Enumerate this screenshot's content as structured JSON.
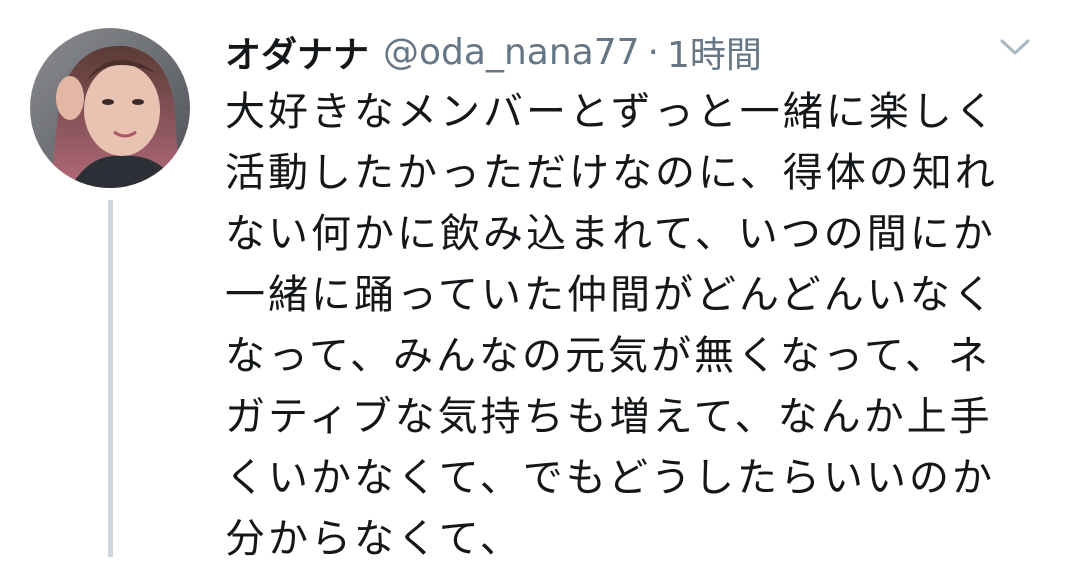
{
  "tweet": {
    "display_name": "オダナナ",
    "handle": "@oda_nana77",
    "separator": "·",
    "timestamp": "1時間",
    "avatar_icon": "profile-photo",
    "menu_icon": "chevron-down-icon",
    "body_lines": [
      "大好きなメンバーとずっと一緒に楽しく",
      "活動したかっただけなのに、得体の知れ",
      "ない何かに飲み込まれて、いつの間にか",
      "一緒に踊っていた仲間がどんどんいなく",
      "なって、みんなの元気が無くなって、ネ",
      "ガティブな気持ちも増えて、なんか上手",
      "くいかなくて、でもどうしたらいいのか",
      "分からなくて、"
    ]
  },
  "colors": {
    "text_primary": "#14171a",
    "text_secondary": "#657786",
    "thread_line": "#cfd7de",
    "background": "#ffffff"
  }
}
